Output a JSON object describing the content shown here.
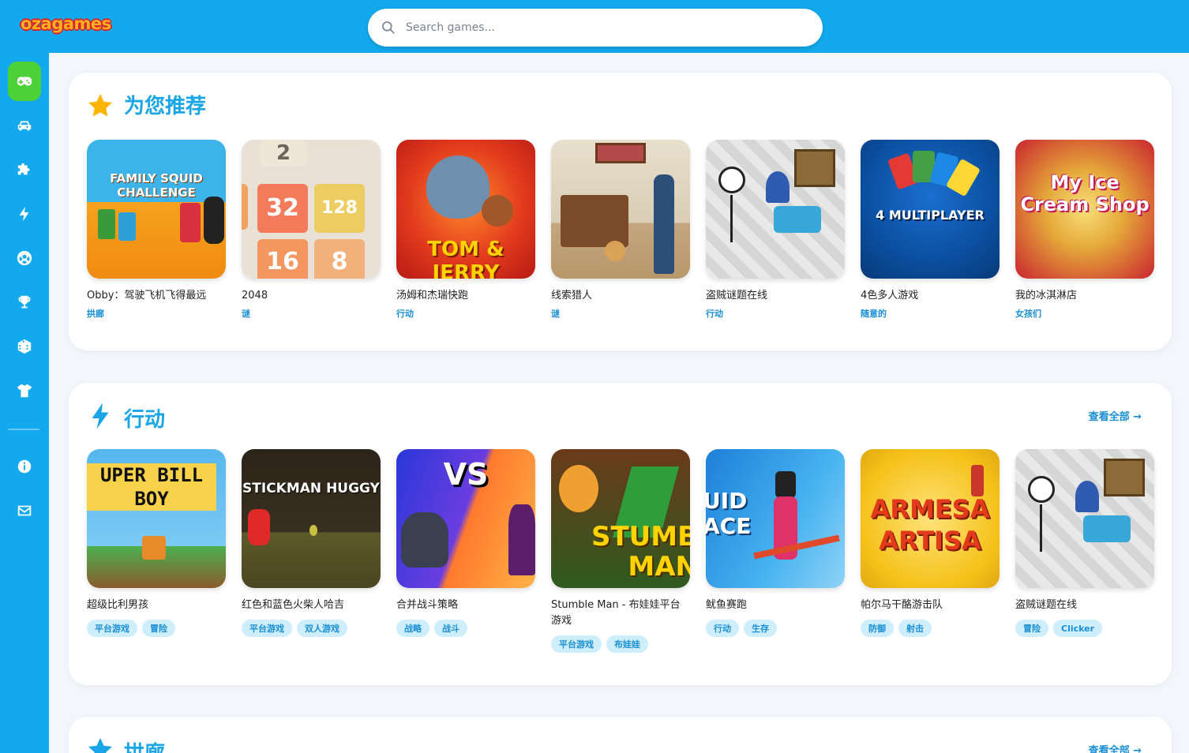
{
  "header": {
    "logo": "ozagames",
    "search_placeholder": "Search games..."
  },
  "sidebar": {
    "items": [
      {
        "icon": "gamepad-icon",
        "active": true
      },
      {
        "icon": "car-icon"
      },
      {
        "icon": "puzzle-icon"
      },
      {
        "icon": "lightning-icon"
      },
      {
        "icon": "soccer-ball-icon"
      },
      {
        "icon": "trophy-icon"
      },
      {
        "icon": "dice-icon"
      },
      {
        "icon": "shirt-icon"
      },
      {
        "icon": "info-icon"
      },
      {
        "icon": "mail-icon"
      }
    ]
  },
  "sections": [
    {
      "title": "为您推荐",
      "icon": "star-icon",
      "games": [
        {
          "title": "Obby：驾驶飞机飞得最远",
          "category": "拱廊",
          "thumb_text": "FAMILY SQUID CHALLENGE",
          "bg": "#f6a21c"
        },
        {
          "title": "2048",
          "category": "谜",
          "thumb_text": "32 128 16 8",
          "bg": "#e9e1d5"
        },
        {
          "title": "汤姆和杰瑞快跑",
          "category": "行动",
          "thumb_text": "TOM & JERRY",
          "bg": "#d82a1f"
        },
        {
          "title": "线索猎人",
          "category": "谜",
          "thumb_text": "",
          "bg": "#d7cdbb"
        },
        {
          "title": "盗贼谜题在线",
          "category": "行动",
          "thumb_text": "",
          "bg": "#e4e4e4"
        },
        {
          "title": "4色多人游戏",
          "category": "随意的",
          "thumb_text": "4 MULTIPLAYER",
          "bg": "#0b4fa0"
        },
        {
          "title": "我的冰淇淋店",
          "category": "女孩们",
          "thumb_text": "My Ice Cream Shop",
          "bg": "#c9242f"
        }
      ]
    },
    {
      "title": "行动",
      "icon": "lightning-icon",
      "view_all": "查看全部 →",
      "games": [
        {
          "title": "超级比利男孩",
          "tags": [
            "平台游戏",
            "冒险"
          ],
          "thumb_text": "UPER BILL BOY",
          "bg": "#3fa8e8"
        },
        {
          "title": "红色和蓝色火柴人哈吉",
          "tags": [
            "平台游戏",
            "双人游戏"
          ],
          "thumb_text": "STICKMAN HUGGY",
          "bg": "#3a3020"
        },
        {
          "title": "合并战斗策略",
          "tags": [
            "战略",
            "战斗"
          ],
          "thumb_text": "VS",
          "bg": "#6a3de0"
        },
        {
          "title": "Stumble Man - 布娃娃平台游戏",
          "tags": [
            "平台游戏",
            "布娃娃"
          ],
          "thumb_text": "STUMB MAN",
          "bg": "#2f9e3a"
        },
        {
          "title": "鱿鱼赛跑",
          "tags": [
            "行动",
            "生存"
          ],
          "thumb_text": "UID ACE",
          "bg": "#2e9be6"
        },
        {
          "title": "帕尔马干酪游击队",
          "tags": [
            "防御",
            "射击"
          ],
          "thumb_text": "ARMESA ARTISA",
          "bg": "#f5c21a"
        },
        {
          "title": "盗贼谜题在线",
          "tags": [
            "冒险",
            "Clicker"
          ],
          "thumb_text": "",
          "bg": "#e4e4e4"
        }
      ]
    },
    {
      "title": "拱廊",
      "icon": "star-icon",
      "view_all": "查看全部 →"
    }
  ]
}
